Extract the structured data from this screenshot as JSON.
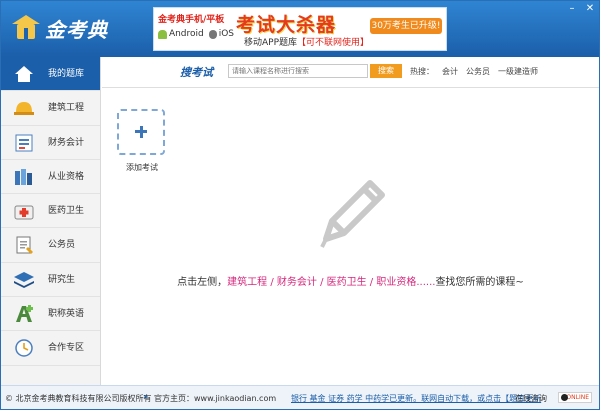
{
  "app": {
    "logo_text": "金考典"
  },
  "banner": {
    "title": "金考典手机/平板",
    "android": "Android",
    "ios": "iOS",
    "headline": "考试大杀器",
    "sub_prefix": "移动APP题库",
    "sub_highlight": "【可不联网使用】",
    "pill": "30万考生已升级!"
  },
  "sidebar": {
    "items": [
      {
        "label": "我的题库",
        "icon": "house-icon"
      },
      {
        "label": "建筑工程",
        "icon": "hardhat-icon"
      },
      {
        "label": "财务会计",
        "icon": "ledger-icon"
      },
      {
        "label": "从业资格",
        "icon": "books-icon"
      },
      {
        "label": "医药卫生",
        "icon": "medkit-icon"
      },
      {
        "label": "公务员",
        "icon": "document-icon"
      },
      {
        "label": "研究生",
        "icon": "layers-icon"
      },
      {
        "label": "职称英语",
        "icon": "letter-a-icon"
      },
      {
        "label": "合作专区",
        "icon": "clock-icon"
      }
    ]
  },
  "search": {
    "title": "搜考试",
    "placeholder": "请输入课程名称进行搜索",
    "button": "搜索",
    "hot_label": "热搜：",
    "hot": [
      "会计",
      "公务员",
      "一级建造师"
    ]
  },
  "main": {
    "add_label": "添加考试",
    "hint_prefix": "点击左侧，",
    "hint_links": "建筑工程 / 财务会计 / 医药卫生 / 职业资格......",
    "hint_suffix": "查找您所需的课程~"
  },
  "footer": {
    "copyright": "© 北京金考典教育科技有限公司版权所有",
    "sep": "»",
    "site": "官方主页：www.jinkaodian.com",
    "news": "银行 基金 证券 药学 中药学已更新。联网自动下载，或点击【题库更新",
    "consult": "在线咨询",
    "online": "ONLINE"
  },
  "colors": {
    "brand_blue": "#1b5ea9",
    "accent_orange": "#f29c1f",
    "link_pink": "#d6277c"
  }
}
